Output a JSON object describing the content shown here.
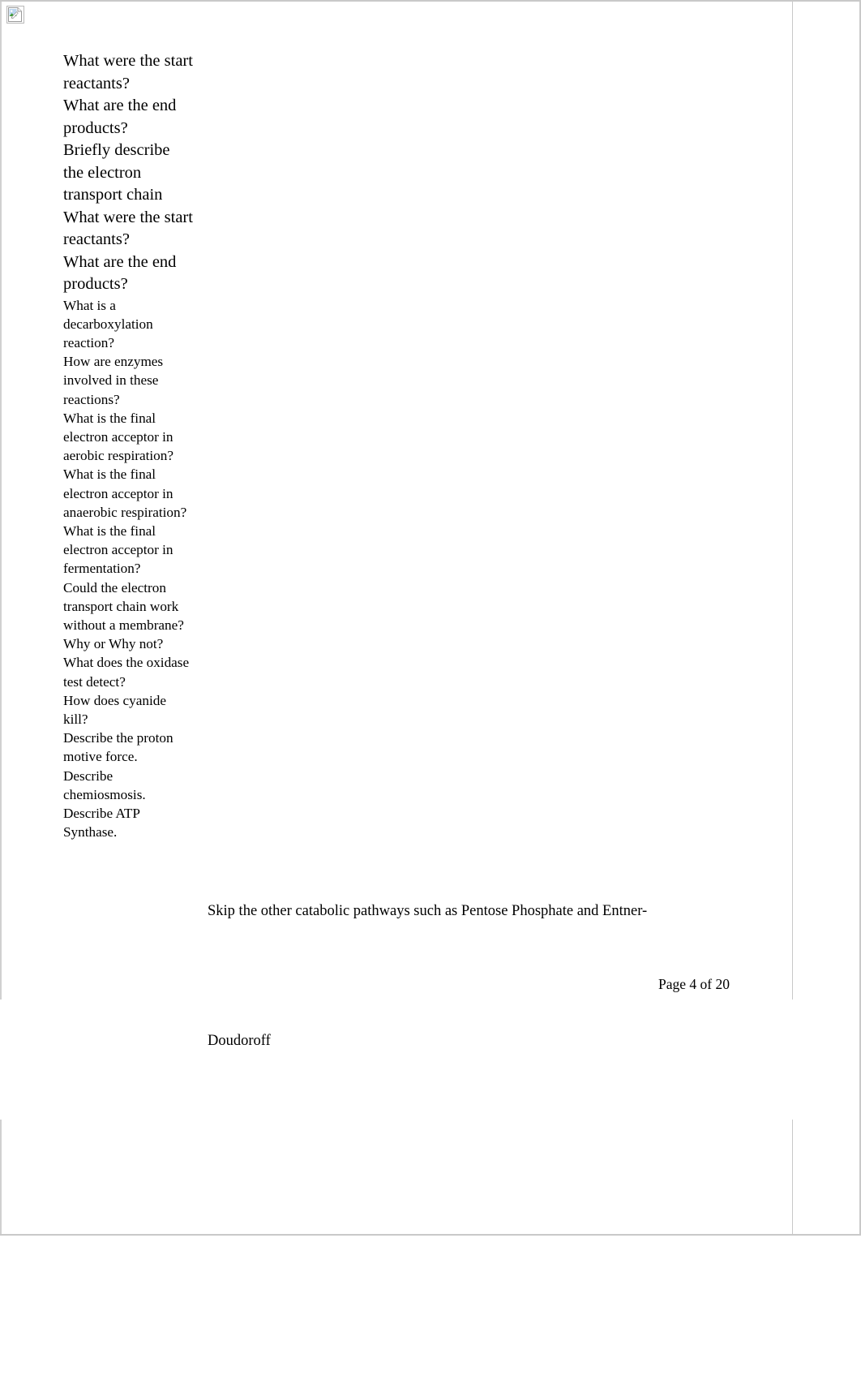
{
  "document": {
    "image_placeholder": {
      "alt": "",
      "icon": "broken-image-icon"
    },
    "questions": [
      {
        "text": "What were the start reactants?",
        "size": "large"
      },
      {
        "text": "What are the end products?",
        "size": "large"
      },
      {
        "text": "Briefly describe the electron transport chain",
        "size": "large"
      },
      {
        "text": "What were the start reactants?",
        "size": "large"
      },
      {
        "text": "What are the end products?",
        "size": "large"
      },
      {
        "text": "What is a decarboxylation reaction?",
        "size": "small"
      },
      {
        "text": "How are enzymes involved in these reactions?",
        "size": "small"
      },
      {
        "text": "What is the final electron acceptor in aerobic respiration?",
        "size": "small"
      },
      {
        "text": "What is the final electron acceptor in anaerobic respiration?",
        "size": "small"
      },
      {
        "text": "What is the final electron acceptor in fermentation?",
        "size": "small"
      },
      {
        "text": "Could the electron transport chain work without a membrane? Why or Why not?",
        "size": "small"
      },
      {
        "text": "What does the oxidase test detect?",
        "size": "small"
      },
      {
        "text": "How does cyanide kill?",
        "size": "small"
      },
      {
        "text": "Describe the proton motive force.",
        "size": "small"
      },
      {
        "text": "Describe chemiosmosis.",
        "size": "small"
      },
      {
        "text": "Describe ATP Synthase.",
        "size": "small"
      }
    ],
    "body_note": "Skip the other catabolic pathways such as Pentose Phosphate and Entner-",
    "body_note_continuation": "Doudoroff",
    "footer": {
      "page_label": "Page 4 of 20",
      "current_page": 4,
      "total_pages": 20
    },
    "colors": {
      "page_border": "#c8c8c8",
      "text": "#000000",
      "background": "#ffffff"
    }
  }
}
